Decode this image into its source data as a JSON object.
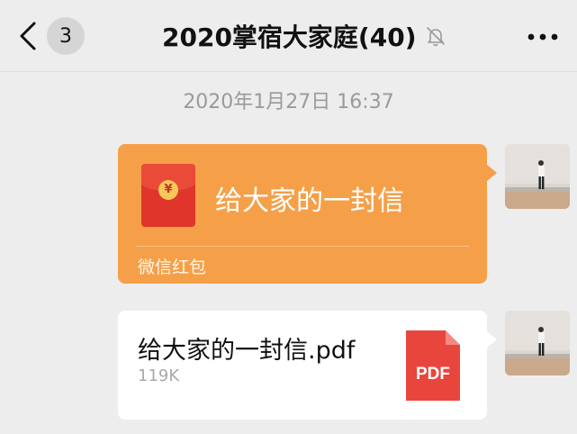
{
  "navbar": {
    "unread_count": "3",
    "title": "2020掌宿大家庭(40)"
  },
  "chat": {
    "timestamp": "2020年1月27日 16:37",
    "red_packet": {
      "title": "给大家的一封信",
      "footer": "微信红包",
      "coin_symbol": "¥"
    },
    "file": {
      "name": "给大家的一封信.pdf",
      "size": "119K",
      "type_label": "PDF"
    }
  },
  "colors": {
    "red_packet_bg": "#f5a049",
    "envelope_red": "#e0352b",
    "pdf_red": "#e8463c",
    "background": "#ededed"
  },
  "icons": {
    "back": "chevron-left-icon",
    "mute": "bell-off-icon",
    "more": "more-dots-icon",
    "file_type": "pdf-file-icon"
  }
}
